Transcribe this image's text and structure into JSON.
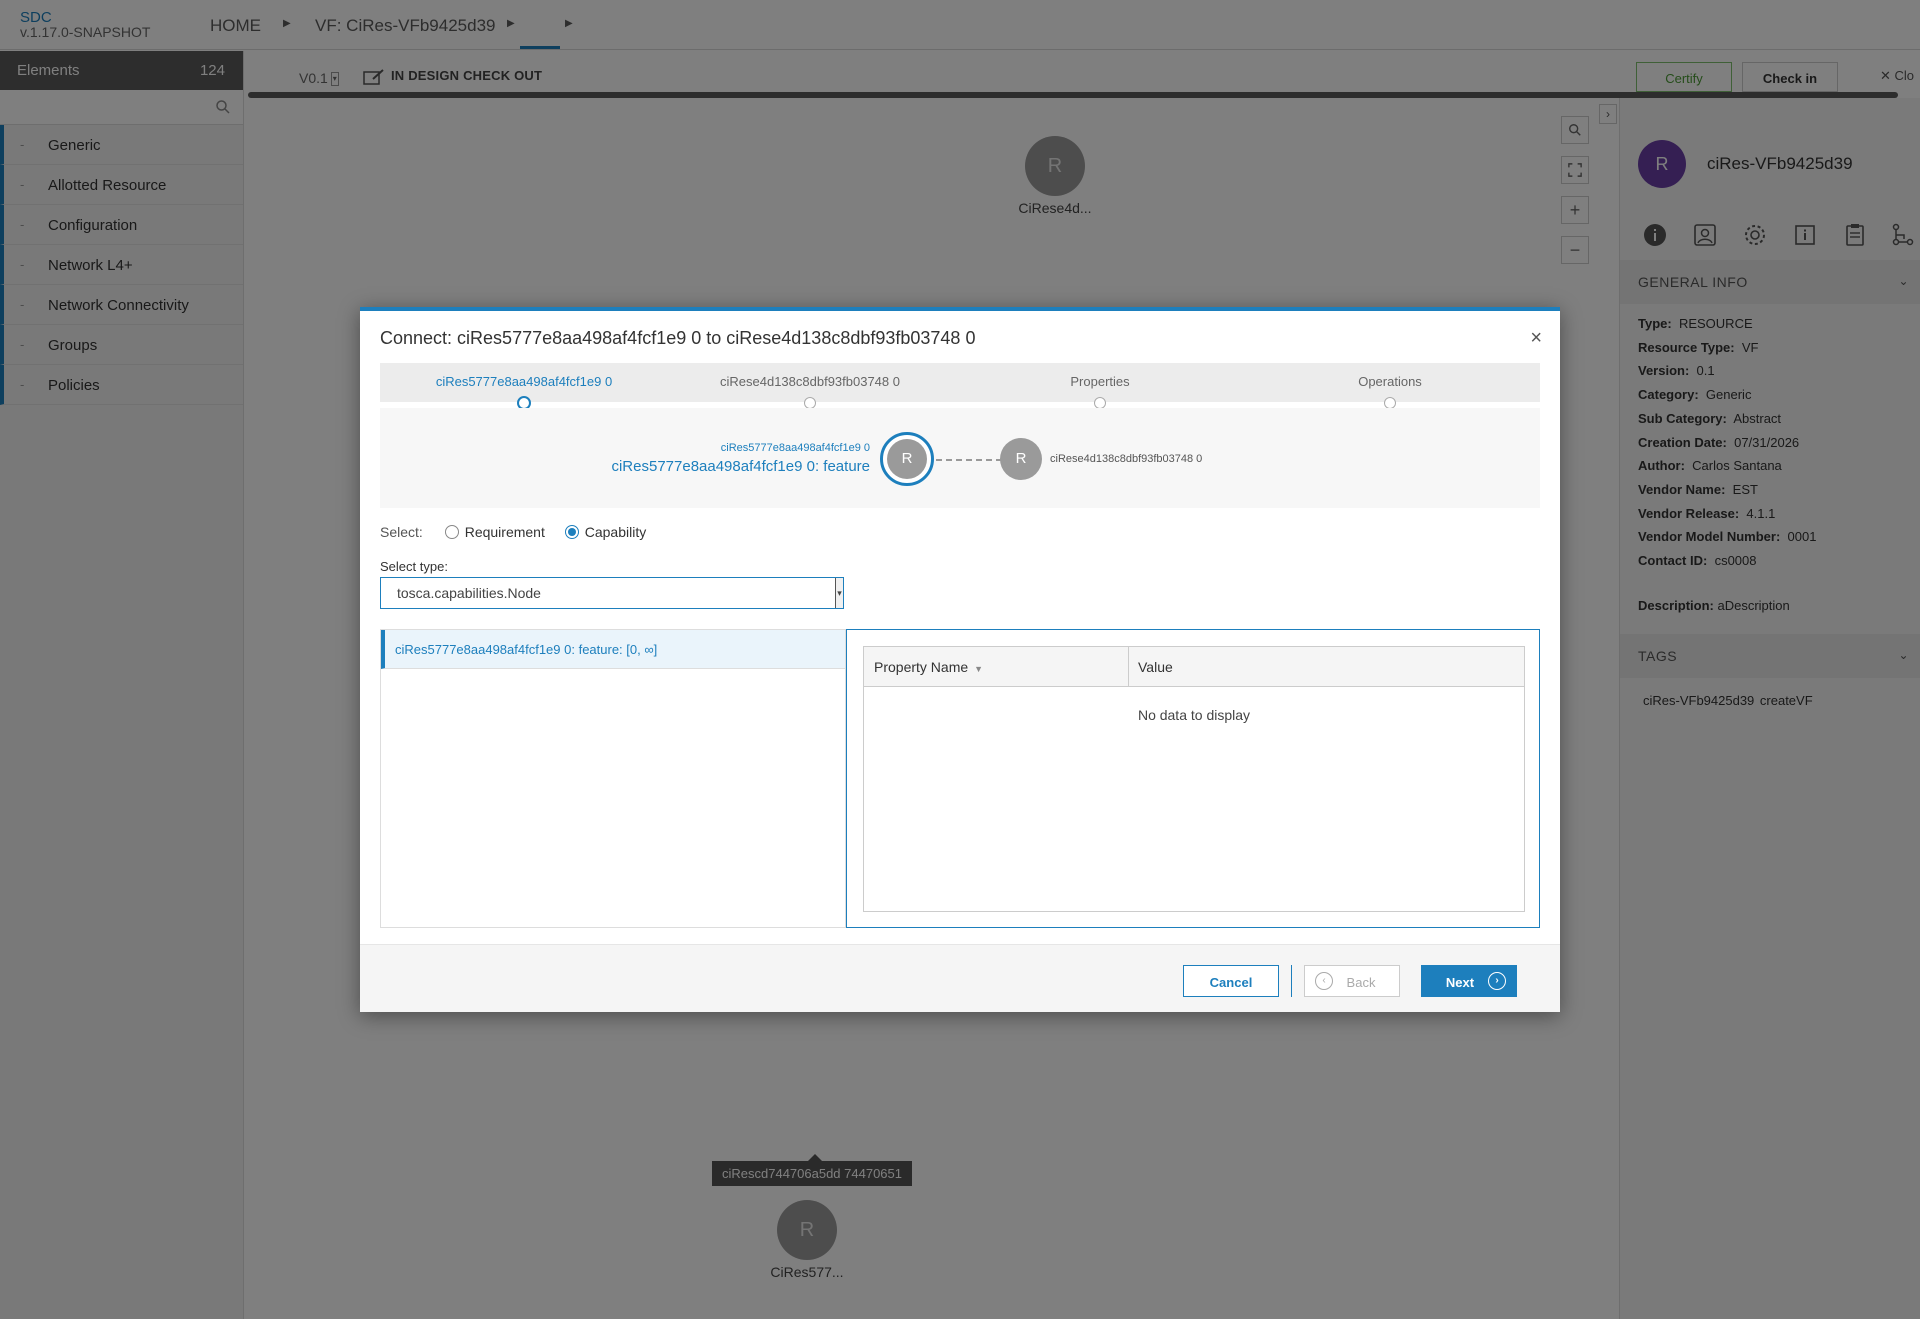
{
  "header": {
    "app_name": "SDC",
    "app_version": "v.1.17.0-SNAPSHOT",
    "crumb_home": "HOME",
    "crumb_vf": "VF: CiRes-VFb9425d39"
  },
  "palette": {
    "title": "Elements",
    "count": "124",
    "search_placeholder": "",
    "items": [
      {
        "label": "Generic"
      },
      {
        "label": "Allotted Resource"
      },
      {
        "label": "Configuration"
      },
      {
        "label": "Network L4+"
      },
      {
        "label": "Network Connectivity"
      },
      {
        "label": "Groups"
      },
      {
        "label": "Policies"
      }
    ]
  },
  "toolbar": {
    "version": "V0.1",
    "status": "IN DESIGN CHECK OUT",
    "certify": "Certify",
    "checkin": "Check in",
    "close": "Clo"
  },
  "canvas": {
    "node_letter": "R",
    "node_top_label": "CiRese4d...",
    "node_bottom_label": "CiRes577...",
    "tooltip": "ciRescd744706a5dd 74470651"
  },
  "right_panel": {
    "avatar": "R",
    "title": "ciRes-VFb9425d39",
    "general_info_title": "GENERAL INFO",
    "info": [
      {
        "label": "Type:",
        "value": "RESOURCE"
      },
      {
        "label": "Resource Type:",
        "value": "VF"
      },
      {
        "label": "Version:",
        "value": "0.1"
      },
      {
        "label": "Category:",
        "value": "Generic"
      },
      {
        "label": "Sub Category:",
        "value": "Abstract"
      },
      {
        "label": "Creation Date:",
        "value": "07/31/2026"
      },
      {
        "label": "Author:",
        "value": "Carlos Santana"
      },
      {
        "label": "Vendor Name:",
        "value": "EST"
      },
      {
        "label": "Vendor Release:",
        "value": "4.1.1"
      },
      {
        "label": "Vendor Model Number:",
        "value": "0001"
      },
      {
        "label": "Contact ID:",
        "value": "cs0008"
      }
    ],
    "description_label": "Description:",
    "description_value": "aDescription",
    "tags_title": "TAGS",
    "tags": "ciRes-VFb9425d39   createVF"
  },
  "modal": {
    "title": "Connect: ciRes5777e8aa498af4fcf1e9 0 to ciRese4d138c8dbf93fb03748 0",
    "close_glyph": "×",
    "steps": [
      {
        "label": "ciRes5777e8aa498af4fcf1e9 0"
      },
      {
        "label": "ciRese4d138c8dbf93fb03748 0"
      },
      {
        "label": "Properties"
      },
      {
        "label": "Operations"
      }
    ],
    "preview": {
      "from_small": "ciRes5777e8aa498af4fcf1e9 0",
      "from_big": "ciRes5777e8aa498af4fcf1e9 0: feature",
      "node_letter": "R",
      "to_label": "ciRese4d138c8dbf93fb03748 0"
    },
    "select_label": "Select:",
    "requirement": "Requirement",
    "capability": "Capability",
    "select_type_label": "Select type:",
    "select_type_value": "tosca.capabilities.Node",
    "capability_item": "ciRes5777e8aa498af4fcf1e9 0: feature: [0, ∞]",
    "table": {
      "col_name": "Property Name",
      "col_value": "Value",
      "empty": "No data to display"
    },
    "buttons": {
      "cancel": "Cancel",
      "back": "Back",
      "next": "Next"
    }
  }
}
